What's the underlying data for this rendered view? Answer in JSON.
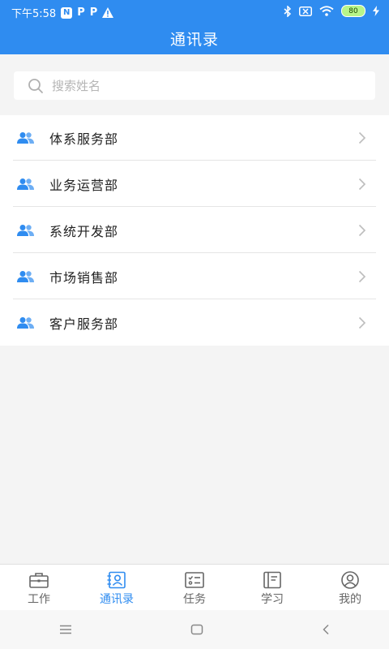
{
  "status_bar": {
    "time": "下午5:58",
    "notif_n": "N",
    "notif_p1": "P",
    "notif_p2": "P",
    "battery": "80"
  },
  "header": {
    "title": "通讯录"
  },
  "search": {
    "placeholder": "搜索姓名",
    "value": ""
  },
  "departments": [
    {
      "name": "体系服务部"
    },
    {
      "name": "业务运营部"
    },
    {
      "name": "系统开发部"
    },
    {
      "name": "市场销售部"
    },
    {
      "name": "客户服务部"
    }
  ],
  "tabs": [
    {
      "label": "工作",
      "icon": "briefcase-icon"
    },
    {
      "label": "通讯录",
      "icon": "contacts-icon",
      "active": true
    },
    {
      "label": "任务",
      "icon": "task-list-icon"
    },
    {
      "label": "学习",
      "icon": "book-icon"
    },
    {
      "label": "我的",
      "icon": "user-icon"
    }
  ],
  "colors": {
    "accent": "#2f8cf0",
    "background": "#f4f4f4"
  }
}
